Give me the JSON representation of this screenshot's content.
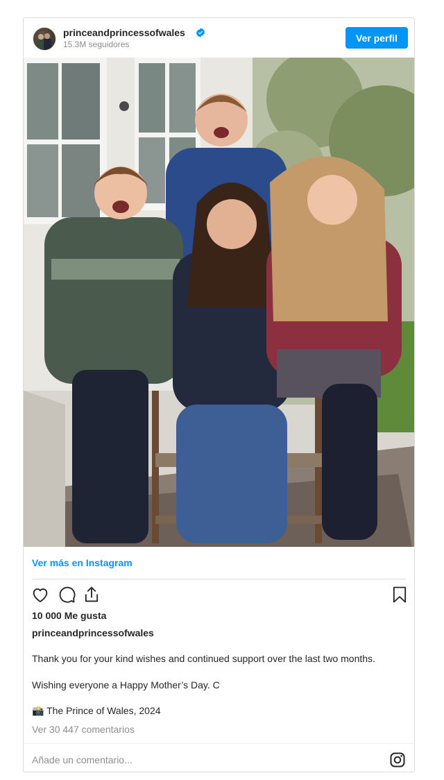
{
  "post": {
    "username": "princeandprincessofwales",
    "followers": "15.3M seguidores",
    "view_profile_label": "Ver perfil",
    "view_more_label": "Ver más en Instagram",
    "likes": "10 000 Me gusta",
    "caption_user": "princeandprincessofwales",
    "caption_lines": [
      "Thank you for your kind wishes and continued support over the last two months.",
      "Wishing everyone a Happy Mother’s Day. C",
      "📸 The Prince of Wales, 2024"
    ],
    "comments_link": "Ver 30 447 comentarios",
    "comment_placeholder": "Añade un comentario..."
  },
  "icons": {
    "verified": "verified-badge-icon",
    "like": "heart-icon",
    "comment": "comment-icon",
    "share": "share-icon",
    "save": "bookmark-icon",
    "instagram": "instagram-logo-icon"
  },
  "colors": {
    "accent": "#0095f6",
    "text": "#262626",
    "muted": "#8e8e8e",
    "border": "#dbdbdb"
  }
}
